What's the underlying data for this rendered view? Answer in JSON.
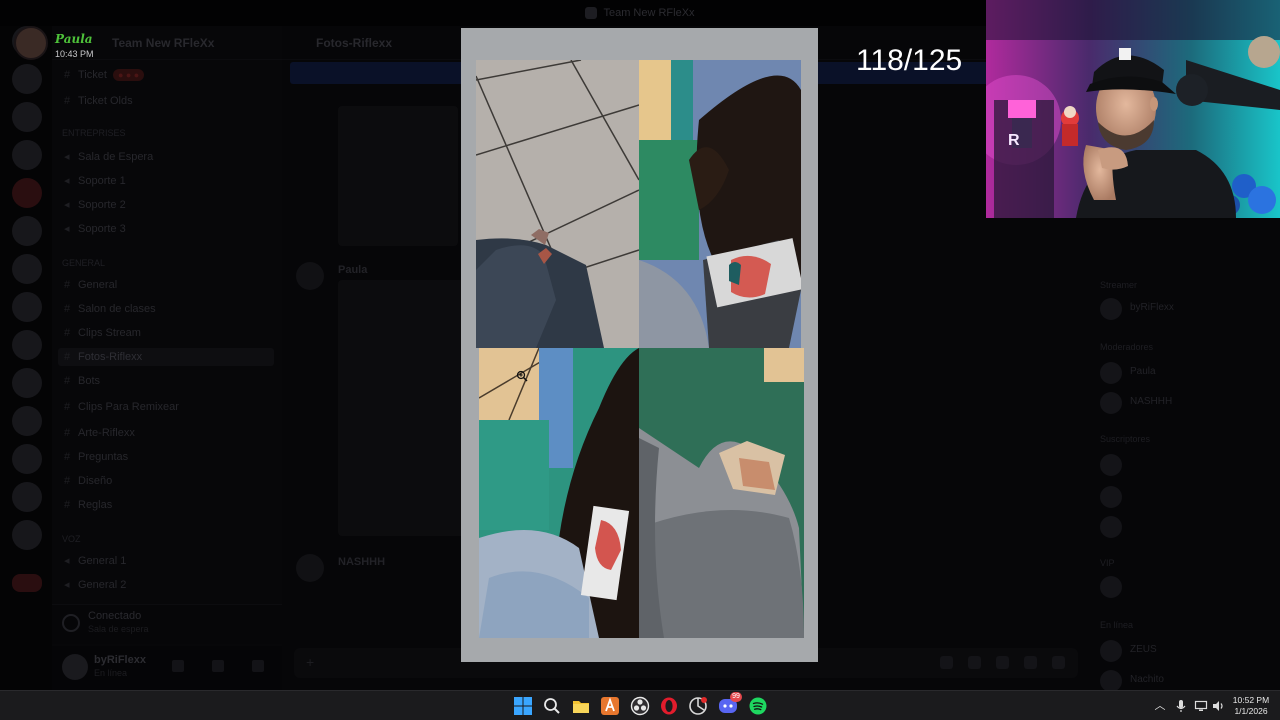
{
  "window": {
    "title": "Team New RFleXx"
  },
  "overlay": {
    "image_counter": "118/125"
  },
  "paula_badge": {
    "name": "Paula",
    "time": "10:43 PM"
  },
  "server": {
    "name": "Team New RFleXx"
  },
  "channels": [
    {
      "label": "Ticket",
      "badge": ""
    },
    {
      "label": "Ticket Olds",
      "badge": ""
    },
    {
      "label": "ENTREPRISES",
      "category": true
    },
    {
      "label": "Sala de Espera"
    },
    {
      "label": "Soporte 1"
    },
    {
      "label": "Soporte 2"
    },
    {
      "label": "Soporte 3"
    },
    {
      "label": "GENERAL",
      "category": true
    },
    {
      "label": "General"
    },
    {
      "label": "Salon de clases"
    },
    {
      "label": "Clips Stream"
    },
    {
      "label": "Fotos-Riflexx",
      "active": true
    },
    {
      "label": "Bots"
    },
    {
      "label": "Clips Para Remixear"
    },
    {
      "label": "Arte-Riflexx"
    },
    {
      "label": "Preguntas"
    },
    {
      "label": "Diseño"
    },
    {
      "label": "Reglas"
    },
    {
      "label": "VOZ",
      "category": true
    },
    {
      "label": "General 1"
    },
    {
      "label": "General 2"
    }
  ],
  "voice_status": {
    "line1": "Conectado",
    "line2": "Sala de espera"
  },
  "user": {
    "name": "byRiFlexx",
    "status": "En línea"
  },
  "chat": {
    "channel_title": "Fotos-Riflexx",
    "banner": "",
    "authors": [
      "Paula",
      "NASHHH"
    ]
  },
  "members": {
    "categories": [
      "Streamer",
      "Moderadores",
      "Suscriptores",
      "VIP",
      "En línea"
    ],
    "names": [
      "byRiFlexx",
      "Paula",
      "NASHHH",
      "ZEUS",
      "Nachito"
    ]
  },
  "taskbar": {
    "apps": [
      "windows-start",
      "search",
      "file-explorer",
      "app-a",
      "obs",
      "opera",
      "chrome",
      "discord",
      "spotify"
    ],
    "discord_badge": "99",
    "time": "10:52 PM",
    "date": "1/1/2026"
  },
  "colors": {
    "lightbox_frame": "#a6a9ac",
    "taskbar": "#1b1b1d",
    "paula_green": "#4ec23a",
    "counter": "#ffffff"
  }
}
